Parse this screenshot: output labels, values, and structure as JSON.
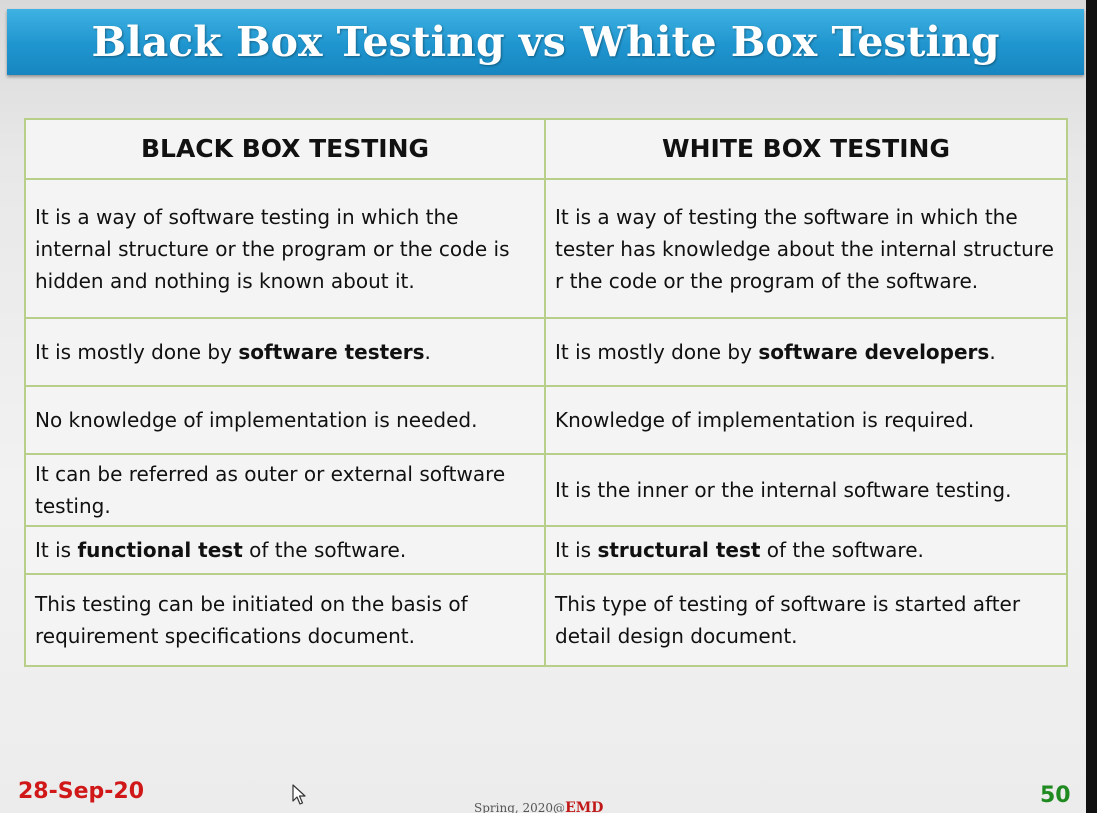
{
  "slide": {
    "title": "Black Box Testing vs White Box Testing",
    "date": "28-Sep-20",
    "page_number": "50",
    "footer_credit_prefix": "Spring, 2020@",
    "footer_credit_brand": "EMD"
  },
  "table": {
    "headers": [
      "BLACK BOX TESTING",
      "WHITE BOX TESTING"
    ],
    "rows": [
      {
        "black": "It is a way of software testing in which the internal structure or the program or the code is hidden and nothing is known about it.",
        "white": "It is a way of testing the software in which the tester has knowledge about the internal structure r the code or the program of the software."
      },
      {
        "black_pre": "It is mostly done by ",
        "black_bold": "software testers",
        "black_post": ".",
        "white_pre": "It is mostly done by ",
        "white_bold": "software developers",
        "white_post": "."
      },
      {
        "black": "No knowledge of implementation is needed.",
        "white": "Knowledge of implementation is required."
      },
      {
        "black": "It can be referred as outer or external software testing.",
        "white": "It is the inner or the internal software testing."
      },
      {
        "black_pre": "It is ",
        "black_bold": "functional test",
        "black_post": " of the software.",
        "white_pre": "It is ",
        "white_bold": "structural test",
        "white_post": " of the software."
      },
      {
        "black": "This testing can be initiated on the basis of requirement specifications document.",
        "white": "This type of testing of software is started after detail design document."
      }
    ]
  },
  "icons": {
    "cursor": "mouse-pointer-icon"
  },
  "colors": {
    "title_bar": "#1f95cf",
    "table_border": "#b8cf8a",
    "date": "#d01818",
    "page_number": "#1f8a1f"
  }
}
